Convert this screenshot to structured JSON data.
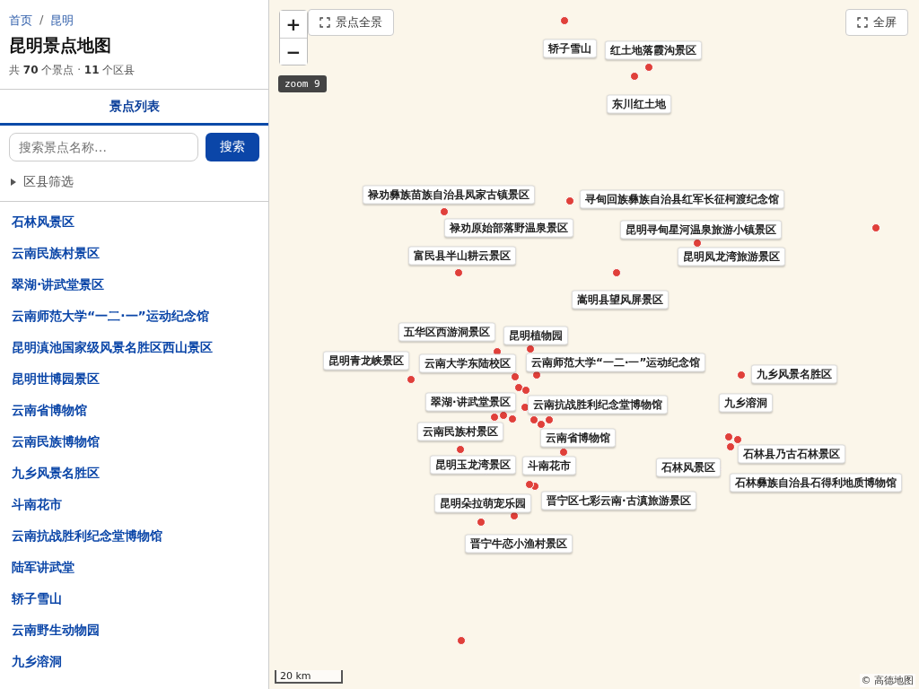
{
  "breadcrumb": {
    "separator": "/",
    "items": [
      {
        "label": "首页"
      },
      {
        "label": "昆明"
      }
    ]
  },
  "title": "昆明景点地图",
  "summary": "共 **70** 个景点 · **11** 个区县",
  "tabs": [
    {
      "label": "景点列表",
      "selected": true
    }
  ],
  "search": {
    "placeholder": "搜索景点名称…",
    "button": "搜索"
  },
  "filter": {
    "label": "区县筛选",
    "expanded": false
  },
  "spots": [
    "石林风景区",
    "云南民族村景区",
    "翠湖·讲武堂景区",
    "云南师范大学“一二·一”运动纪念馆",
    "昆明滇池国家级风景名胜区西山景区",
    "昆明世博园景区",
    "云南省博物馆",
    "云南民族博物馆",
    "九乡风景名胜区",
    "斗南花市",
    "云南抗战胜利纪念堂博物馆",
    "陆军讲武堂",
    "轿子雪山",
    "云南野生动物园",
    "九乡溶洞"
  ],
  "map": {
    "zoom_in": "+",
    "zoom_out": "−",
    "fit_button": "景点全景",
    "fullscreen_button": "全屏",
    "zoom_badge": "zoom 9",
    "scale": "20 km",
    "attribution": "© 高德地图",
    "labels": [
      "轿子雪山",
      "红土地落霞沟景区",
      "东川红土地",
      "禄劝彝族苗族自治县凤家古镇景区",
      "寻甸回族彝族自治县红军长征柯渡纪念馆",
      "禄劝原始部落野温泉景区",
      "昆明寻甸星河温泉旅游小镇景区",
      "富民县半山耕云景区",
      "昆明凤龙湾旅游景区",
      "嵩明县望风屏景区",
      "五华区西游洞景区",
      "昆明植物园",
      "昆明青龙峡景区",
      "云南大学东陆校区",
      "云南师范大学“一二·一”运动纪念馆",
      "九乡风景名胜区",
      "翠湖·讲武堂景区",
      "云南抗战胜利纪念堂博物馆",
      "九乡溶洞",
      "云南民族村景区",
      "云南省博物馆",
      "石林县乃古石林景区",
      "昆明玉龙湾景区",
      "斗南花市",
      "石林风景区",
      "石林彝族自治县石得利地质博物馆",
      "昆明朵拉萌宠乐园",
      "晋宁区七彩云南·古滇旅游景区",
      "晋宁牛恋小渔村景区"
    ]
  }
}
